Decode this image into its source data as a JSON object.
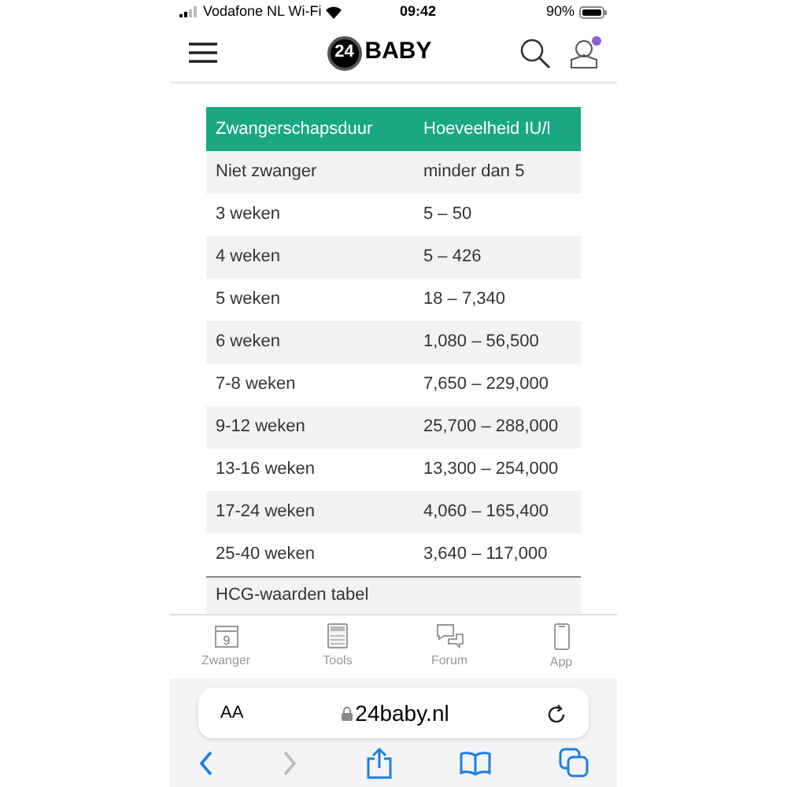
{
  "status_bar": {
    "carrier": "Vodafone NL Wi-Fi",
    "time": "09:42",
    "battery": "90%"
  },
  "header": {
    "logo_number": "24",
    "logo_text": "BABY",
    "notification": true
  },
  "table": {
    "columns": [
      "Zwangerschapsduur",
      "Hoeveelheid IU/l"
    ],
    "rows": [
      [
        "Niet zwanger",
        "minder dan 5"
      ],
      [
        "3 weken",
        "5 – 50"
      ],
      [
        "4 weken",
        "5 – 426"
      ],
      [
        "5 weken",
        "18 – 7,340"
      ],
      [
        "6 weken",
        "1,080 – 56,500"
      ],
      [
        "7-8 weken",
        "7,650 – 229,000"
      ],
      [
        "9-12 weken",
        "25,700 – 288,000"
      ],
      [
        "13-16 weken",
        "13,300 – 254,000"
      ],
      [
        "17-24 weken",
        "4,060 – 165,400"
      ],
      [
        "25-40 weken",
        "3,640 – 117,000"
      ]
    ],
    "caption": "HCG-waarden tabel"
  },
  "tab_bar": [
    {
      "kind": "calendar",
      "label": "Zwanger",
      "badge": "9"
    },
    {
      "kind": "calculator",
      "label": "Tools"
    },
    {
      "kind": "chat",
      "label": "Forum"
    },
    {
      "kind": "phone",
      "label": "App"
    }
  ],
  "browser": {
    "text_size": "AA",
    "url": "24baby.nl",
    "back_enabled": true,
    "forward_enabled": false
  }
}
